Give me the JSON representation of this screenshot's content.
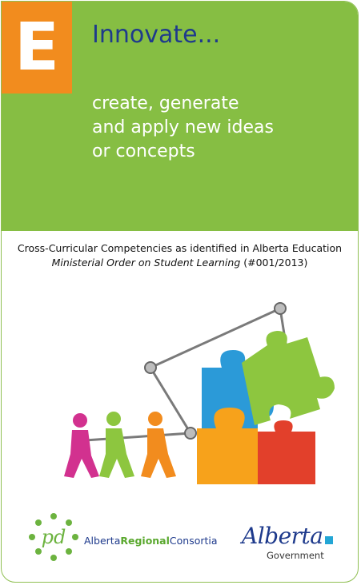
{
  "header": {
    "letter": "E",
    "title": "Innovate...",
    "description_lines": [
      "create, generate",
      "and apply new ideas",
      "or concepts"
    ]
  },
  "reference": {
    "line1": "Cross-Curricular Competencies as identified in Alberta Education",
    "line2_italic": "Ministerial Order on Student Learning",
    "line2_rest": " (#001/2013)"
  },
  "footer": {
    "arc_logo_letters": "pd",
    "arc_name_part1": "Alberta",
    "arc_name_part2": "Regional",
    "arc_name_part3": "Consortia",
    "gov_word": "Alberta",
    "gov_sub": "Government"
  },
  "colors": {
    "green": "#86be43",
    "orange": "#f28c1e",
    "navy": "#1e3a8c",
    "blue": "#23a6d5"
  },
  "icons": [
    "puzzle-illustration",
    "arc-logo",
    "alberta-logo"
  ]
}
